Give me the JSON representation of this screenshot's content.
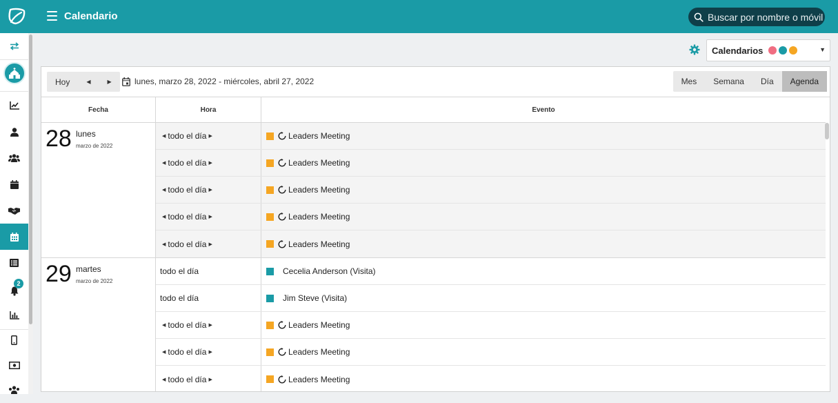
{
  "header": {
    "title": "Calendario",
    "search_placeholder": "Buscar por nombre o móvil"
  },
  "sidebar": {
    "notification_count": "2",
    "icons": [
      "swap-icon",
      "church-icon",
      "chart-icon",
      "user-icon",
      "users-icon",
      "calendar-icon",
      "handshake-icon",
      "calendar-grid-icon",
      "list-icon",
      "bell-icon",
      "bar-chart-icon",
      "mobile-icon",
      "money-icon",
      "group-icon"
    ]
  },
  "calendars": {
    "label": "Calendarios",
    "colors": [
      "#f06e82",
      "#1a9ba6",
      "#f5a623"
    ]
  },
  "toolbar": {
    "today": "Hoy",
    "range": "lunes, marzo 28, 2022 - miércoles, abril 27, 2022",
    "views": [
      "Mes",
      "Semana",
      "Día",
      "Agenda"
    ],
    "active_view": "Agenda"
  },
  "agenda": {
    "headers": {
      "date": "Fecha",
      "time": "Hora",
      "event": "Evento"
    },
    "days": [
      {
        "num": "28",
        "name": "lunes",
        "sub": "marzo de 2022",
        "events": [
          {
            "time": "todo el día",
            "arrows": true,
            "title": "Leaders Meeting",
            "color": "#f5a623",
            "recurring": true
          },
          {
            "time": "todo el día",
            "arrows": true,
            "title": "Leaders Meeting",
            "color": "#f5a623",
            "recurring": true
          },
          {
            "time": "todo el día",
            "arrows": true,
            "title": "Leaders Meeting",
            "color": "#f5a623",
            "recurring": true
          },
          {
            "time": "todo el día",
            "arrows": true,
            "title": "Leaders Meeting",
            "color": "#f5a623",
            "recurring": true
          },
          {
            "time": "todo el día",
            "arrows": true,
            "title": "Leaders Meeting",
            "color": "#f5a623",
            "recurring": true
          }
        ]
      },
      {
        "num": "29",
        "name": "martes",
        "sub": "marzo de 2022",
        "events": [
          {
            "time": "todo el día",
            "arrows": false,
            "title": "Cecelia Anderson (Visita)",
            "color": "#1a9ba6",
            "recurring": false
          },
          {
            "time": "todo el día",
            "arrows": false,
            "title": "Jim Steve (Visita)",
            "color": "#1a9ba6",
            "recurring": false
          },
          {
            "time": "todo el día",
            "arrows": true,
            "title": "Leaders Meeting",
            "color": "#f5a623",
            "recurring": true
          },
          {
            "time": "todo el día",
            "arrows": true,
            "title": "Leaders Meeting",
            "color": "#f5a623",
            "recurring": true
          },
          {
            "time": "todo el día",
            "arrows": true,
            "title": "Leaders Meeting",
            "color": "#f5a623",
            "recurring": true
          }
        ]
      }
    ]
  }
}
